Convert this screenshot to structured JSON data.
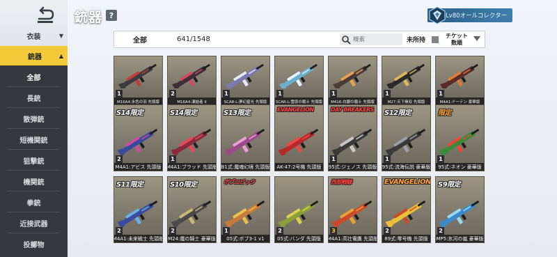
{
  "sidebar": {
    "items": [
      {
        "label": "衣装",
        "type": "top"
      },
      {
        "label": "銃器",
        "type": "category-active"
      },
      {
        "label": "全部",
        "type": "sub-active"
      },
      {
        "label": "長銃",
        "type": "sub"
      },
      {
        "label": "散弾銃",
        "type": "sub"
      },
      {
        "label": "短機関銃",
        "type": "sub"
      },
      {
        "label": "狙撃銃",
        "type": "sub"
      },
      {
        "label": "機関銃",
        "type": "sub"
      },
      {
        "label": "拳銃",
        "type": "sub"
      },
      {
        "label": "近接武器",
        "type": "sub"
      },
      {
        "label": "投擲物",
        "type": "sub"
      }
    ]
  },
  "header": {
    "title": "銃器",
    "help_icon": "question-icon",
    "collector_label": "Lv80オールコレクター"
  },
  "filter": {
    "all_label": "全部",
    "count": "641/1548",
    "search_placeholder": "検索",
    "unowned_label": "未所持",
    "sort_label_line1": "チケット",
    "sort_label_line2": "数順"
  },
  "cards": [
    {
      "badge": "",
      "badge_style": "",
      "stars": "1",
      "name": "M16A4:水色の羽 先頭版",
      "gun": "#3a3a40",
      "accent": "#c23d3d",
      "tall": false
    },
    {
      "badge": "",
      "badge_style": "",
      "stars": "2",
      "name": "M16A4:凍結者 II",
      "gun": "#3d2f3a",
      "accent": "#d04a5a",
      "tall": false
    },
    {
      "badge": "",
      "badge_style": "",
      "stars": "1",
      "name": "SCAR-L:夢幻星光 先頭版",
      "gun": "#7a7ab0",
      "accent": "#e6e6f4",
      "tall": false
    },
    {
      "badge": "",
      "badge_style": "",
      "stars": "1",
      "name": "SCAR-L:雪原の戦士 先頭版",
      "gun": "#6aaed0",
      "accent": "#e8f4ff",
      "tall": false
    },
    {
      "badge": "",
      "badge_style": "",
      "stars": "1",
      "name": "M416:白銀の戦士 先頭版",
      "gun": "#4a3a3a",
      "accent": "#e8a050",
      "tall": false
    },
    {
      "badge": "",
      "badge_style": "",
      "stars": "1",
      "name": "M27:天下無双 先頭版",
      "gun": "#2a2a2a",
      "accent": "#d9b85a",
      "tall": false
    },
    {
      "badge": "",
      "badge_style": "",
      "stars": "1",
      "name": "M4A1:ドーテン 豪華版",
      "gun": "#5a2a2a",
      "accent": "#e07a3a",
      "tall": false
    },
    {
      "badge": "S14限定",
      "badge_style": "white",
      "stars": "2",
      "name": "M4A1:アビス 先頭版",
      "gun": "#3a4a9a",
      "accent": "#d04aa0",
      "tall": true
    },
    {
      "badge": "S14限定",
      "badge_style": "white",
      "stars": "1",
      "name": "M4A1:ブラッド 先頭版",
      "gun": "#8a2a3a",
      "accent": "#e84a5a",
      "tall": true
    },
    {
      "badge": "S13限定",
      "badge_style": "white",
      "stars": "",
      "name": "B1式:魔魂幻境 先頭版",
      "gun": "#9a4a8a",
      "accent": "#e8a0d0",
      "tall": true
    },
    {
      "badge": "EVANGELION",
      "badge_style": "red",
      "stars": "",
      "name": "AK-47:2号機 先頭版",
      "gun": "#b82a2a",
      "accent": "#e84a4a",
      "tall": true
    },
    {
      "badge": "DAY BREAKERS",
      "badge_style": "red",
      "stars": "1",
      "name": "95式:ジェノス 先頭版",
      "gun": "#3a3a3a",
      "accent": "#c8c8c8",
      "tall": true
    },
    {
      "badge": "S12限定",
      "badge_style": "white",
      "stars": "1",
      "name": "95式:流海伝説 豪華版",
      "gun": "#3a3a3a",
      "accent": "#9aa0aa",
      "tall": true
    },
    {
      "badge": "限定",
      "badge_style": "orange",
      "stars": "1",
      "name": "95式:ネオン 豪華版",
      "gun": "#3a8a3a",
      "accent": "#e84a3a",
      "tall": true
    },
    {
      "badge": "S11限定",
      "badge_style": "white",
      "stars": "2",
      "name": "M4A1:未来戦士 先頭版",
      "gun": "#3a4aa0",
      "accent": "#6ab0e0",
      "tall": true
    },
    {
      "badge": "S10限定",
      "badge_style": "white",
      "stars": "2",
      "name": "M24:魔の騎士 豪華版",
      "gun": "#4a4a4a",
      "accent": "#c8b878",
      "tall": true
    },
    {
      "badge": "ボブエピック",
      "badge_style": "red",
      "stars": "1",
      "name": "05式:ボブ3-1 v1",
      "gun": "#c87a3a",
      "accent": "#e8c050",
      "tall": true
    },
    {
      "badge": "",
      "badge_style": "",
      "stars": "2",
      "name": "05式:バンダ 先頭版",
      "gun": "#8aa03a",
      "accent": "#d8d050",
      "tall": true
    },
    {
      "badge": "西部戦線",
      "badge_style": "red",
      "stars": "3",
      "name": "M4A1:高壮電鷹 先頭版",
      "gun": "#c84a2a",
      "accent": "#e8a03a",
      "tall": true
    },
    {
      "badge": "EVANGELION",
      "badge_style": "orange",
      "stars": "2",
      "name": "89式:零号機 先頭版",
      "gun": "#e8c03a",
      "accent": "#c84a2a",
      "tall": true
    },
    {
      "badge": "S9限定",
      "badge_style": "white",
      "stars": "2",
      "name": "MP5:氷河の嵐 豪華版",
      "gun": "#3a8ac8",
      "accent": "#9ad8f0",
      "tall": true
    }
  ]
}
